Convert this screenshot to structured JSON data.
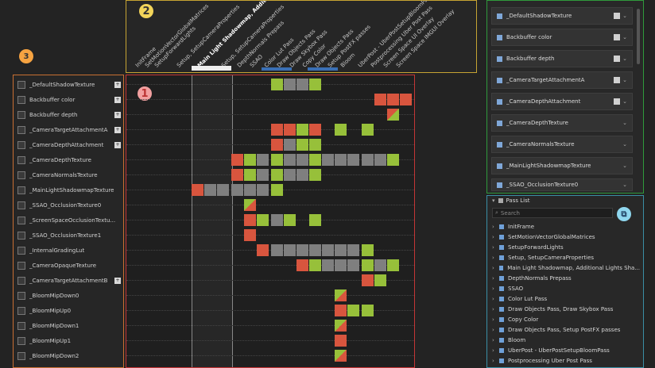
{
  "badges": {
    "one": "1",
    "two": "2",
    "three": "3"
  },
  "resources": [
    "_DefaultShadowTexture",
    "Backbuffer color",
    "Backbuffer depth",
    "_CameraTargetAttachmentA",
    "_CameraDepthAttachment",
    "_CameraDepthTexture",
    "_CameraNormalsTexture",
    "_MainLightShadowmapTexture",
    "_SSAO_OcclusionTexture0",
    "_ScreenSpaceOcclusionTextu...",
    "_SSAO_OcclusionTexture1",
    "_InternalGradingLut",
    "_CameraOpaqueTexture",
    "_CameraTargetAttachmentB",
    "_BloomMipDown0",
    "_BloomMipUp0",
    "_BloomMipDown1",
    "_BloomMipUp1",
    "_BloomMipDown2"
  ],
  "pass_headers": [
    "InitFrame",
    "SetMotionVectorGlobalMatrices",
    "SetupForwardLights",
    "Setup, SetupCameraProperties",
    "Main Light Shadowmap, Additional Lights Shadowmap",
    "Setup, SetupCameraProperties",
    "DepthNormals Prepass",
    "SSAO",
    "Color Lut Pass",
    "Draw Objects Pass",
    "Draw Skybox Pass",
    "Copy Color",
    "Draw Objects Pass",
    "Setup PostFX passes",
    "Bloom",
    "UberPost - UberPostSetupBloomPass",
    "Postprocessing Uber Post Pass",
    "Screen Space UI Overlay",
    "Screen Space IMGUI Overlay"
  ],
  "right_top": [
    "_DefaultShadowTexture",
    "Backbuffer color",
    "Backbuffer depth",
    "_CameraTargetAttachmentA",
    "_CameraDepthAttachment",
    "_CameraDepthTexture",
    "_CameraNormalsTexture",
    "_MainLightShadowmapTexture",
    "_SSAO_OcclusionTexture0"
  ],
  "pass_list": {
    "title": "Pass List",
    "search_placeholder": "Search",
    "items": [
      "InitFrame",
      "SetMotionVectorGlobalMatrices",
      "SetupForwardLights",
      "Setup, SetupCameraProperties",
      "Main Light Shadowmap, Additional Lights Sha...",
      "DepthNormals Prepass",
      "SSAO",
      "Color Lut Pass",
      "Draw Objects Pass, Draw Skybox Pass",
      "Copy Color",
      "Draw Objects Pass, Setup PostFX passes",
      "Bloom",
      "UberPost - UberPostSetupBloomPass",
      "Postprocessing Uber Post Pass"
    ]
  },
  "colors": {
    "read": "#97c03a",
    "write": "#d8553e",
    "unused": "#7f7f7f"
  }
}
